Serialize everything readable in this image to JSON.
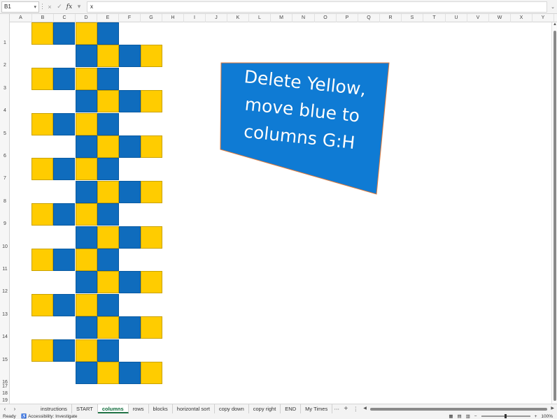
{
  "formula_bar": {
    "cell_ref": "B1",
    "cancel_icon": "×",
    "enter_icon": "✓",
    "fx_label": "fx",
    "formula_value": "x"
  },
  "columns": [
    "A",
    "B",
    "C",
    "D",
    "E",
    "F",
    "G",
    "H",
    "I",
    "J",
    "K",
    "L",
    "M",
    "N",
    "O",
    "P",
    "Q",
    "R",
    "S",
    "T",
    "U",
    "V",
    "W",
    "X",
    "Y"
  ],
  "rows": [
    "1",
    "2",
    "3",
    "4",
    "5",
    "6",
    "7",
    "8",
    "9",
    "10",
    "11",
    "12",
    "13",
    "14",
    "15",
    "16",
    "17",
    "18",
    "19"
  ],
  "pattern": {
    "row_a": [
      "yellow",
      "blue",
      "yellow",
      "blue",
      null,
      null
    ],
    "row_b": [
      null,
      null,
      "blue",
      "yellow",
      "blue",
      "yellow"
    ],
    "pair_count": 8
  },
  "shape": {
    "lines": [
      "Delete Yellow,",
      "move blue to",
      "columns G:H"
    ],
    "fill": "#0f7bd4",
    "outline": "#e07a3a"
  },
  "sheet_tabs": [
    "instructions",
    "START",
    "columns",
    "rows",
    "blocks",
    "horizontal sort",
    "copy down",
    "copy right",
    "END",
    "My Times"
  ],
  "active_tab": "columns",
  "status": {
    "ready": "Ready",
    "accessibility": "Accessibility: Investigate",
    "zoom": "100%"
  },
  "colors": {
    "yellow": "#ffcc00",
    "blue": "#0f6cbd",
    "accent_green": "#217346"
  }
}
